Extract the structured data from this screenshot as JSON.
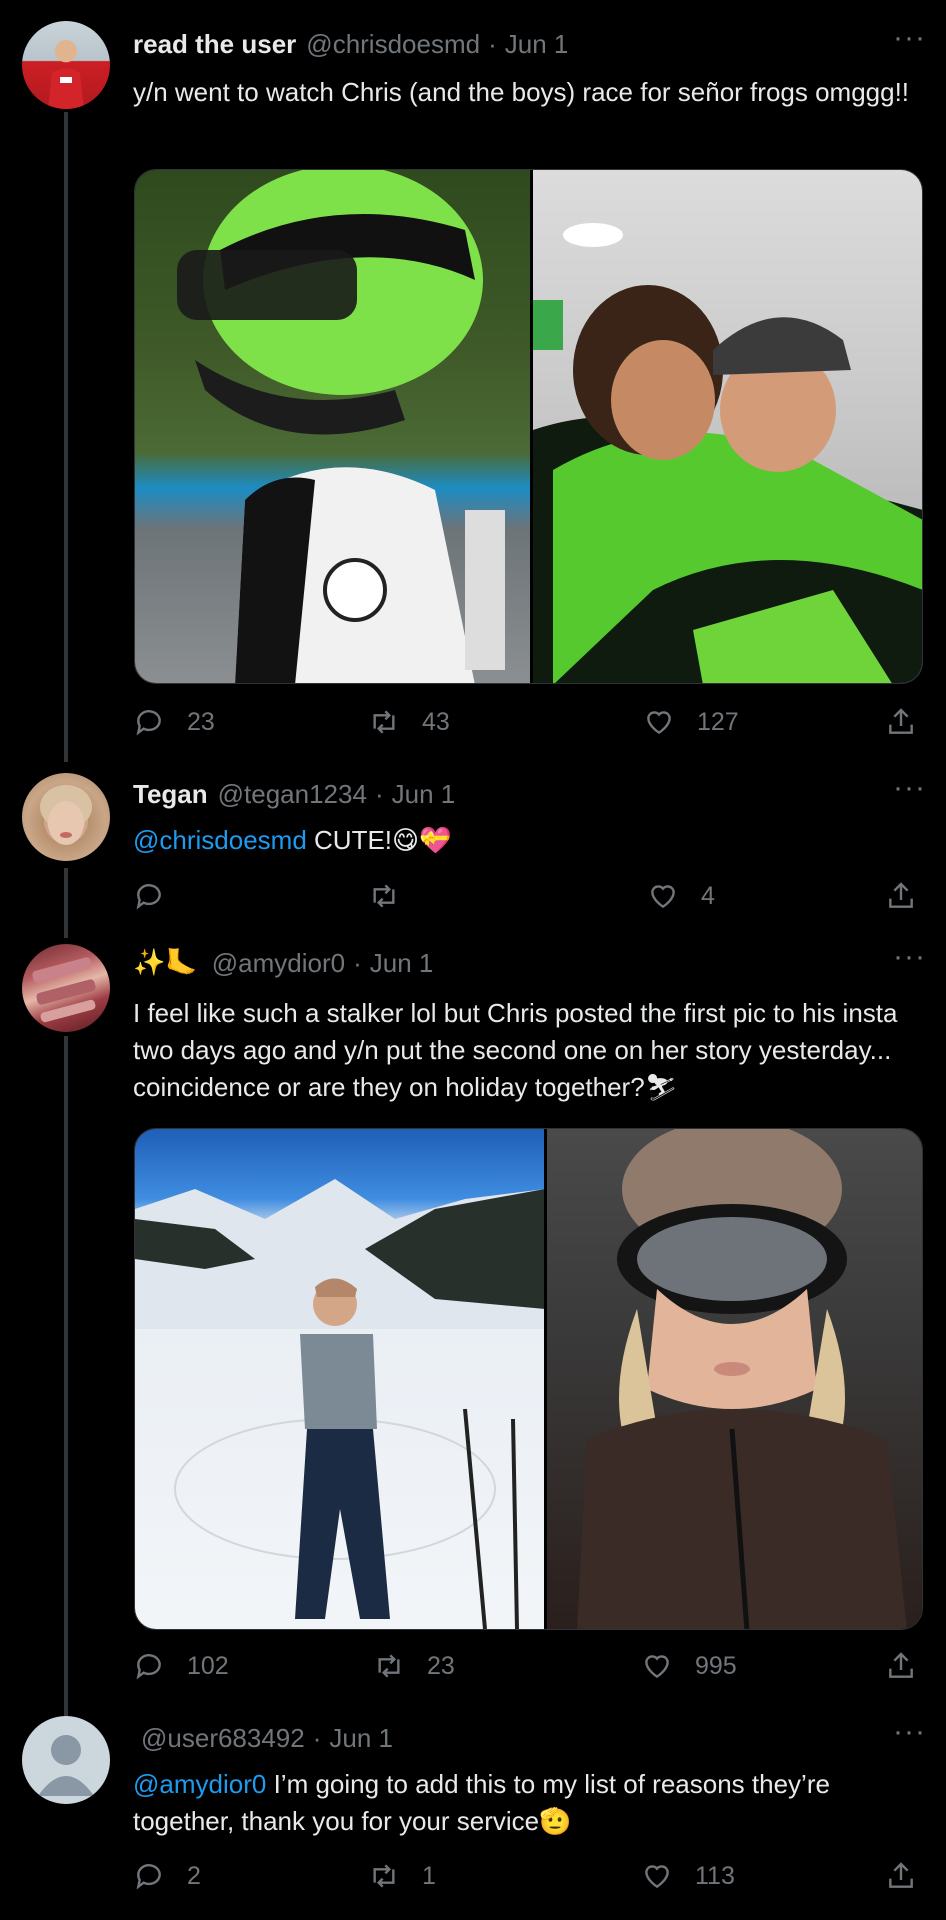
{
  "tweets": [
    {
      "name": "read the user",
      "handle": "@chrisdoesmd",
      "date": "Jun 1",
      "text": "y/n went to watch Chris (and the boys) race for señor frogs omggg!!",
      "replies": "23",
      "retweets": "43",
      "likes": "127"
    },
    {
      "name": "Tegan",
      "handle": "@tegan1234",
      "date": "Jun 1",
      "mention": "@chrisdoesmd",
      "text": "CUTE!",
      "emoji": "😋💝",
      "replies": "",
      "retweets": "",
      "likes": "4"
    },
    {
      "name": "✨🦶",
      "handle": "@amydior0",
      "date": "Jun 1",
      "text": "I feel like such a stalker lol but Chris posted the first pic to his insta two days ago and y/n put the second one on her story yesterday... coincidence or are they on holiday together?",
      "emoji": "⛷",
      "replies": "102",
      "retweets": "23",
      "likes": "995"
    },
    {
      "name": "",
      "handle": "@user683492",
      "date": "Jun 1",
      "mention": "@amydior0",
      "text": "I’m going to add this to my list of reasons they’re together, thank you for your service",
      "emoji": "🫡",
      "replies": "2",
      "retweets": "1",
      "likes": "113"
    }
  ],
  "more_label": "···",
  "sep": "·"
}
